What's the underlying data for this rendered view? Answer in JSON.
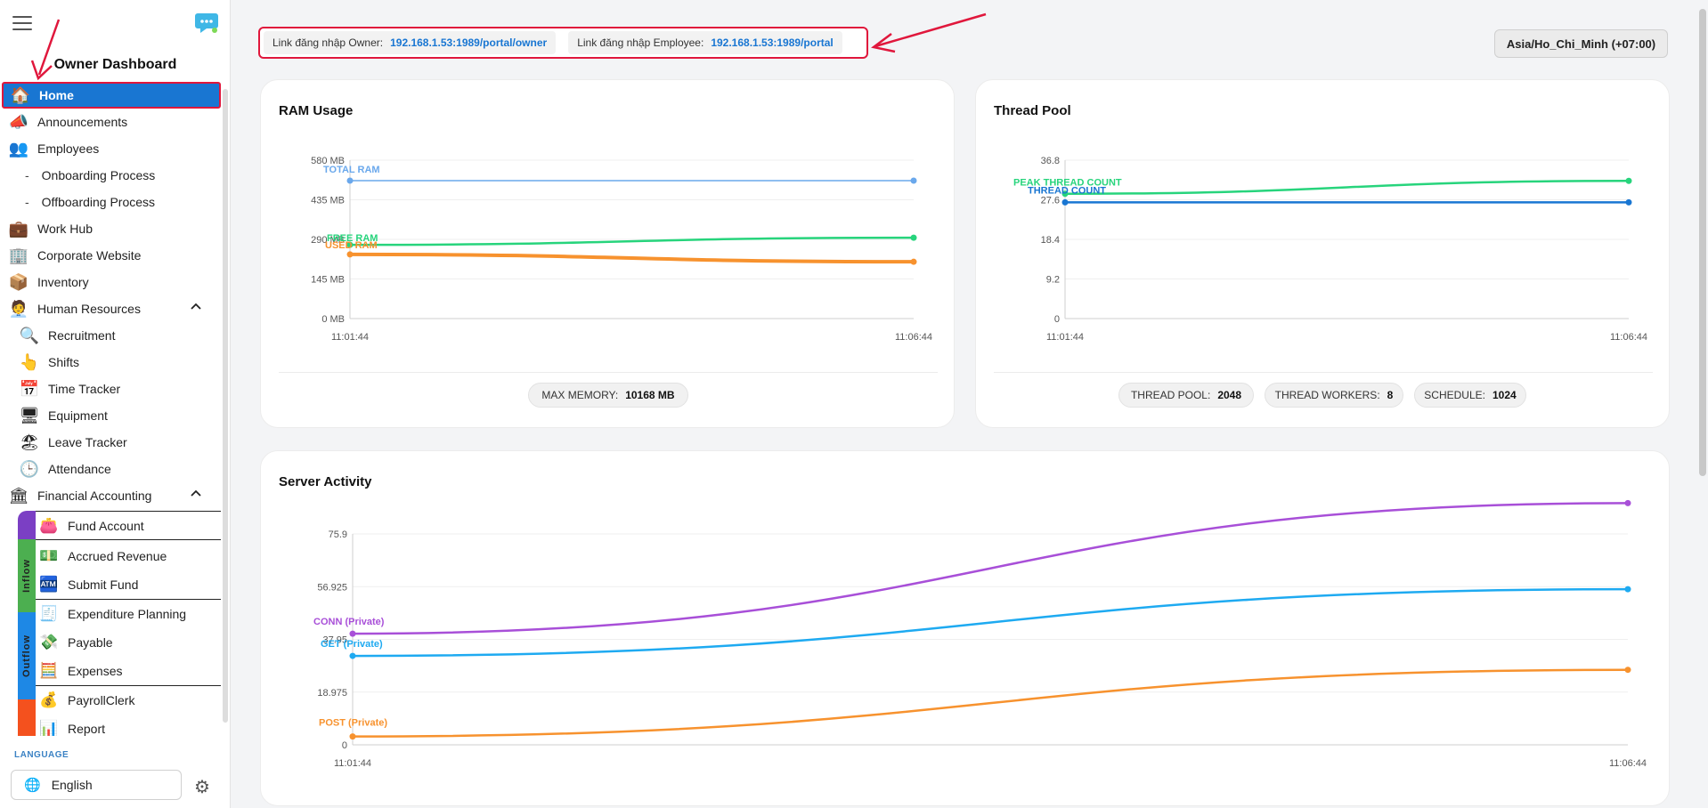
{
  "sidebar": {
    "title": "Owner Dashboard",
    "items": [
      {
        "label": "Home",
        "icon": "home-icon",
        "glyph": "🏠",
        "active": true
      },
      {
        "label": "Announcements",
        "icon": "megaphone-icon",
        "glyph": "📣"
      },
      {
        "label": "Employees",
        "icon": "employees-icon",
        "glyph": "👥"
      },
      {
        "label": "Onboarding Process"
      },
      {
        "label": "Offboarding Process"
      },
      {
        "label": "Work Hub",
        "icon": "briefcase-icon",
        "glyph": "💼"
      },
      {
        "label": "Corporate Website",
        "icon": "building-icon",
        "glyph": "🏢"
      },
      {
        "label": "Inventory",
        "icon": "inventory-icon",
        "glyph": "📦"
      },
      {
        "label": "Human Resources",
        "icon": "hr-icon",
        "glyph": "🧑‍💼"
      },
      {
        "label": "Recruitment",
        "icon": "recruitment-icon",
        "glyph": "🔍"
      },
      {
        "label": "Shifts",
        "icon": "shifts-icon",
        "glyph": "👆"
      },
      {
        "label": "Time Tracker",
        "icon": "calendar-icon",
        "glyph": "📅"
      },
      {
        "label": "Equipment",
        "icon": "equipment-icon",
        "glyph": "🖥"
      },
      {
        "label": "Leave Tracker",
        "icon": "leave-icon",
        "glyph": "🏖"
      },
      {
        "label": "Attendance",
        "icon": "attendance-icon",
        "glyph": "🕒"
      },
      {
        "label": "Financial Accounting",
        "icon": "finance-icon",
        "glyph": "🏛"
      }
    ],
    "finance_items": [
      {
        "label": "Fund Account",
        "icon": "wallet-icon",
        "glyph": "👛"
      },
      {
        "label": "Accrued Revenue",
        "icon": "revenue-icon",
        "glyph": "💵"
      },
      {
        "label": "Submit Fund",
        "icon": "submit-fund-icon",
        "glyph": "🏧"
      },
      {
        "label": "Expenditure Planning",
        "icon": "planning-icon",
        "glyph": "🧾"
      },
      {
        "label": "Payable",
        "icon": "payable-icon",
        "glyph": "💸"
      },
      {
        "label": "Expenses",
        "icon": "expenses-icon",
        "glyph": "🧮"
      },
      {
        "label": "PayrollClerk",
        "icon": "payroll-icon",
        "glyph": "💰"
      },
      {
        "label": "Report",
        "icon": "report-icon",
        "glyph": "📊"
      }
    ],
    "bands": {
      "inflow": "Inflow",
      "outflow": "Outflow"
    },
    "colors": {
      "active": "#1976d2",
      "highlight": "#e0173c",
      "band_top": "#7b3fc4",
      "band_inflow": "#4caf50",
      "band_outflow": "#1e88e5",
      "band_bottom": "#f4511e"
    },
    "language_label": "LANGUAGE",
    "language_value": "English"
  },
  "topbar": {
    "owner_label": "Link đăng nhập Owner:",
    "owner_link": "192.168.1.53:1989/portal/owner",
    "employee_label": "Link đăng nhập Employee:",
    "employee_link": "192.168.1.53:1989/portal",
    "timezone": "Asia/Ho_Chi_Minh (+07:00)"
  },
  "ram_card": {
    "title": "RAM Usage",
    "max_memory_label": "MAX MEMORY:",
    "max_memory_value": "10168 MB"
  },
  "thread_card": {
    "title": "Thread Pool",
    "thread_pool_label": "THREAD POOL:",
    "thread_pool_value": "2048",
    "thread_workers_label": "THREAD WORKERS:",
    "thread_workers_value": "8",
    "schedule_label": "SCHEDULE:",
    "schedule_value": "1024"
  },
  "server_card": {
    "title": "Server Activity"
  },
  "chart_data": [
    {
      "type": "line",
      "title": "RAM Usage",
      "x": [
        "11:01:44",
        "11:06:44"
      ],
      "y_ticks": [
        "0 MB",
        "145 MB",
        "290 MB",
        "435 MB",
        "580 MB"
      ],
      "ylim": [
        0,
        580
      ],
      "series": [
        {
          "name": "TOTAL RAM",
          "color": "#6aa8ec",
          "values": [
            505,
            505
          ]
        },
        {
          "name": "FREE RAM",
          "color": "#27d47c",
          "values": [
            270,
            296
          ]
        },
        {
          "name": "USED RAM",
          "color": "#f7922e",
          "values": [
            235,
            208
          ]
        }
      ]
    },
    {
      "type": "line",
      "title": "Thread Pool",
      "x": [
        "11:01:44",
        "11:06:44"
      ],
      "y_ticks": [
        "0",
        "9.2",
        "18.4",
        "27.6",
        "36.8"
      ],
      "ylim": [
        0,
        36.8
      ],
      "series": [
        {
          "name": "PEAK THREAD COUNT",
          "color": "#27d47c",
          "values": [
            29,
            32
          ]
        },
        {
          "name": "THREAD COUNT",
          "color": "#1976d2",
          "values": [
            27,
            27
          ]
        }
      ]
    },
    {
      "type": "line",
      "title": "Server Activity",
      "x": [
        "11:01:44",
        "11:06:44"
      ],
      "y_ticks": [
        "0",
        "18.975",
        "37.95",
        "56.925",
        "75.9"
      ],
      "ylim": [
        0,
        75.9
      ],
      "series": [
        {
          "name": "CONN (Private)",
          "color": "#a84fd8",
          "values": [
            40,
            87
          ]
        },
        {
          "name": "GET (Private)",
          "color": "#1eaaf1",
          "values": [
            32,
            56
          ]
        },
        {
          "name": "POST (Private)",
          "color": "#f7922e",
          "values": [
            3,
            27
          ]
        }
      ]
    }
  ]
}
